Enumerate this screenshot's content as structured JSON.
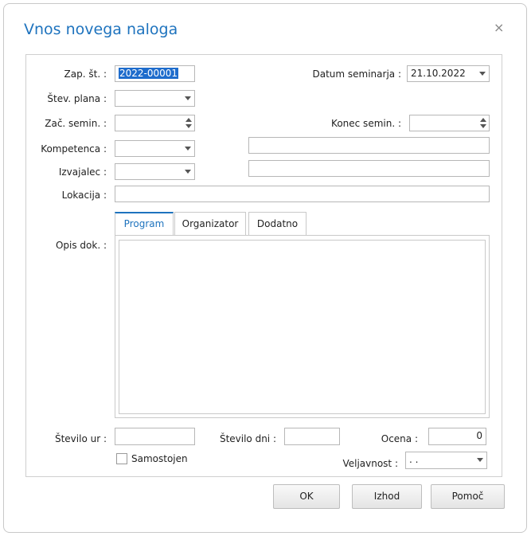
{
  "dialog": {
    "title": "Vnos novega naloga",
    "close_glyph": "×"
  },
  "fields": {
    "zap_st": {
      "label": "Zap. št. :",
      "value": "2022-00001"
    },
    "datum_seminarja": {
      "label": "Datum seminarja :",
      "value": "21.10.2022"
    },
    "stev_plana": {
      "label": "Štev. plana :",
      "value": ""
    },
    "zac_semin": {
      "label": "Zač. semin. :",
      "value": ""
    },
    "konec_semin": {
      "label": "Konec semin. :",
      "value": ""
    },
    "kompetenca": {
      "label": "Kompetenca :",
      "value": "",
      "text": ""
    },
    "izvajalec": {
      "label": "Izvajalec :",
      "value": "",
      "text": ""
    },
    "lokacija": {
      "label": "Lokacija :",
      "value": ""
    },
    "opis_dok": {
      "label": "Opis dok. :"
    },
    "stevilo_ur": {
      "label": "Število ur :",
      "value": ""
    },
    "stevilo_dni": {
      "label": "Število dni :",
      "value": ""
    },
    "ocena": {
      "label": "Ocena :",
      "value": "0"
    },
    "samostojen": {
      "label": "Samostojen",
      "checked": false
    },
    "veljavnost": {
      "label": "Veljavnost :",
      "value": ". ."
    }
  },
  "tabs": [
    {
      "label": "Program",
      "active": true
    },
    {
      "label": "Organizator",
      "active": false
    },
    {
      "label": "Dodatno",
      "active": false
    }
  ],
  "buttons": {
    "ok": "OK",
    "izhod": "Izhod",
    "pomoc": "Pomoč"
  },
  "colors": {
    "accent": "#1e73be",
    "selection": "#1e6ccc"
  },
  "icons": {
    "close": "close-icon",
    "dropdown": "chevron-down-icon",
    "spinner": "spinner-icon"
  }
}
